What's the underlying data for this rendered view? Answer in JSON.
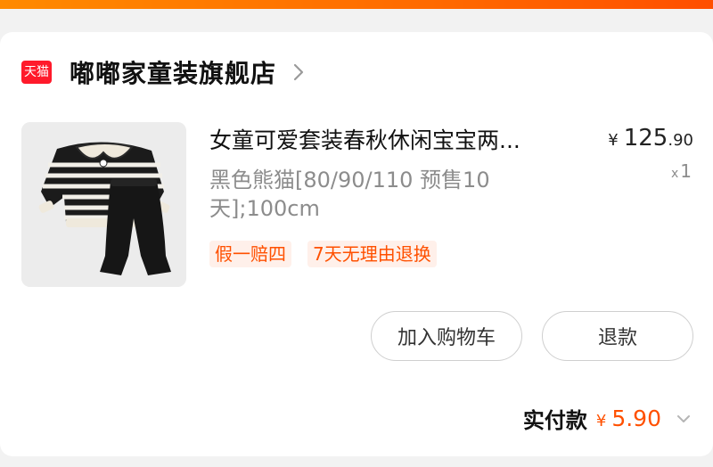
{
  "store": {
    "badge_text": "天猫",
    "badge_color": "#ff1a2b",
    "name": "嘟嘟家童装旗舰店",
    "chevron_icon": "chevron-right-icon"
  },
  "product": {
    "title": "女童可爱套装春秋休闲宝宝两...",
    "spec": "黑色熊猫[80/90/110 预售10天];100cm",
    "tags": [
      "假一赔四",
      "7天无理由退换"
    ],
    "price": {
      "currency": "¥",
      "integer": "125",
      "decimal": ".90"
    },
    "quantity_prefix": "x",
    "quantity": "1",
    "image_icon": "product-image"
  },
  "actions": {
    "add_to_cart_label": "加入购物车",
    "refund_label": "退款"
  },
  "summary": {
    "paid_label": "实付款",
    "paid_currency": "¥",
    "paid_integer": "5",
    "paid_decimal": ".90",
    "chevron_icon": "chevron-down-icon"
  },
  "colors": {
    "accent": "#ff5000",
    "top_strip": "#ff6a00"
  }
}
